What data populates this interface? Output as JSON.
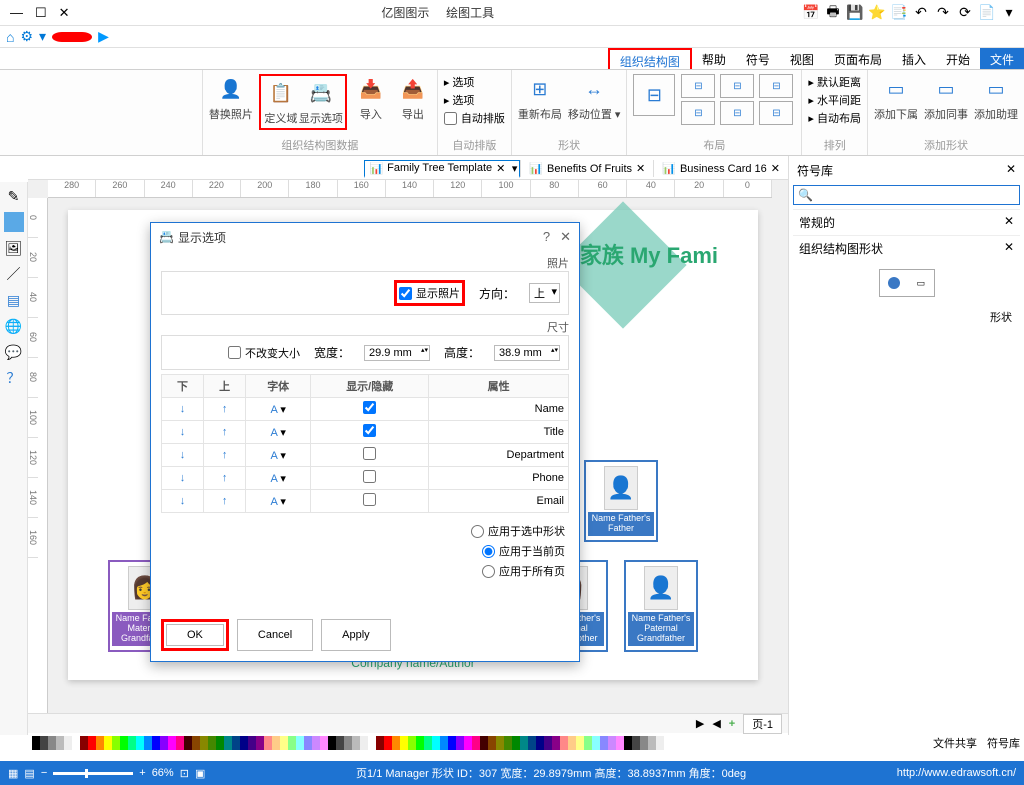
{
  "window": {
    "title": "亿图图示",
    "subtitle": "绘图工具"
  },
  "qat": [
    "📅",
    "🖶",
    "💾",
    "⭐",
    "📑",
    "↶",
    "↷",
    "⟳",
    "📄"
  ],
  "tabs": {
    "primary": "文件",
    "items": [
      "开始",
      "插入",
      "页面布局",
      "视图",
      "符号",
      "帮助",
      "组织结构图"
    ]
  },
  "ribbon": {
    "g1": {
      "label": "添加形状",
      "items": [
        "添加下属",
        "添加同事",
        "添加助理"
      ]
    },
    "g2": {
      "label": "排列",
      "items": [
        "默认距离",
        "水平间距",
        "自动布局"
      ]
    },
    "g3": {
      "label": "布局",
      "layouts": [
        "L1",
        "L2",
        "L3",
        "L4",
        "L5",
        "L6"
      ]
    },
    "g4": {
      "label": "形状",
      "items": [
        "重新布局",
        "移动位置 ▾"
      ]
    },
    "g5": {
      "label": "自动排版",
      "check": "自动排版"
    },
    "g6": {
      "label": "组织结构图数据",
      "items": [
        "替换照片",
        "定义域",
        "显示选项",
        "导入",
        "导出"
      ]
    }
  },
  "sidepanel": {
    "title": "符号库",
    "row1": "常规的",
    "row2": "组织结构图形状",
    "shape": "形状"
  },
  "doctabs": [
    {
      "label": "Business Card 16"
    },
    {
      "label": "Benefits Of Fruits"
    },
    {
      "label": "Family Tree Template",
      "sel": true
    }
  ],
  "page": {
    "title": "我的家族 My Fami",
    "footer": "Company name/Author",
    "nodes": {
      "n1": "Name\nFather's Father",
      "n2": "Name\nFather's Paternal Grandfather",
      "n3": "Name\nFather's Paternal Grandmother",
      "n4": "Name\nFather's Maternal Grandfather"
    }
  },
  "dialog": {
    "title": "显示选项",
    "photo": {
      "legend": "照片",
      "check": "显示照片",
      "dir": "方向：",
      "dirval": "上"
    },
    "size": {
      "legend": "尺寸",
      "lock": "不改变大小",
      "w": "宽度：",
      "wval": "29.9 mm",
      "h": "高度：",
      "hval": "38.9 mm"
    },
    "table": {
      "headers": [
        "属性",
        "显示/隐藏",
        "字体",
        "上",
        "下"
      ],
      "rows": [
        {
          "p": "Name",
          "show": true
        },
        {
          "p": "Title",
          "show": true
        },
        {
          "p": "Department",
          "show": false
        },
        {
          "p": "Phone",
          "show": false
        },
        {
          "p": "Email",
          "show": false
        }
      ]
    },
    "radios": [
      "应用于选中形状",
      "应用于当前页",
      "应用于所有页"
    ],
    "radio_sel": 1,
    "btns": {
      "ok": "OK",
      "cancel": "Cancel",
      "apply": "Apply"
    }
  },
  "pagetabs": {
    "p1": "页-1",
    "add": "+"
  },
  "bottombar": {
    "file": "文件共享",
    "sym": "符号库"
  },
  "status": {
    "url": "http://www.edrawsoft.cn/",
    "info": "页1/1  Manager 形状 ID：307  宽度：29.8979mm  高度：38.8937mm  角度：0deg",
    "zoom": "66%"
  },
  "ruler_h": [
    "0",
    "20",
    "40",
    "60",
    "80",
    "100",
    "120",
    "140",
    "160",
    "180",
    "200",
    "220",
    "240",
    "260",
    "280"
  ],
  "ruler_v": [
    "0",
    "20",
    "40",
    "60",
    "80",
    "100",
    "120",
    "140",
    "160"
  ]
}
